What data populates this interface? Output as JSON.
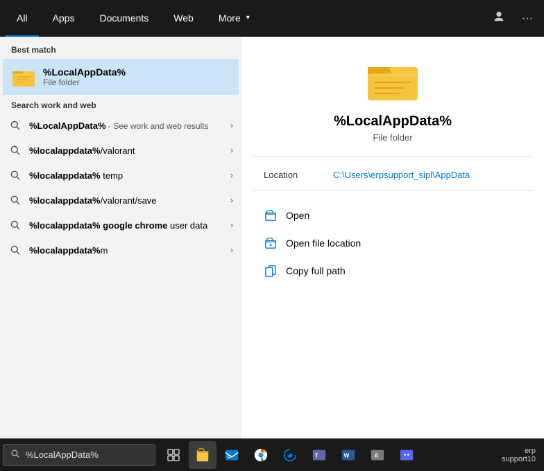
{
  "nav": {
    "tabs": [
      {
        "label": "All",
        "active": true
      },
      {
        "label": "Apps",
        "active": false
      },
      {
        "label": "Documents",
        "active": false
      },
      {
        "label": "Web",
        "active": false
      },
      {
        "label": "More",
        "active": false
      }
    ],
    "more_icon": "▾",
    "person_icon": "👤",
    "dots_icon": "···"
  },
  "left_panel": {
    "best_match_label": "Best match",
    "best_match": {
      "title": "%LocalAppData%",
      "subtitle": "File folder"
    },
    "search_section_label": "Search work and web",
    "search_items": [
      {
        "text_plain": "%LocalAppData%",
        "text_muted": " - See work and web results",
        "bold": "%LocalAppData%"
      },
      {
        "text_plain": "%localappdata%/valorant",
        "bold": "%localappdata%",
        "text_suffix": "/valorant"
      },
      {
        "text_plain": "%localappdata% temp",
        "bold": "%localappdata%",
        "text_suffix": " temp"
      },
      {
        "text_plain": "%localappdata%/valorant/save",
        "bold": "%localappdata%",
        "text_suffix": "/valorant/save"
      },
      {
        "text_plain": "%localappdata% google chrome user data",
        "bold": "%localappdata%",
        "text_suffix": " google chrome user data"
      },
      {
        "text_plain": "%localappdata%m",
        "bold": "%localappdata%",
        "text_suffix": "m"
      }
    ]
  },
  "right_panel": {
    "title": "%LocalAppData%",
    "subtitle": "File folder",
    "location_label": "Location",
    "location_value": "C:\\Users\\erpsupport_sipl\\AppData",
    "actions": [
      {
        "label": "Open",
        "icon": "folder_open"
      },
      {
        "label": "Open file location",
        "icon": "folder_loc"
      },
      {
        "label": "Copy full path",
        "icon": "copy"
      }
    ]
  },
  "taskbar": {
    "search_value": "%LocalAppData%",
    "search_placeholder": "%LocalAppData%"
  }
}
